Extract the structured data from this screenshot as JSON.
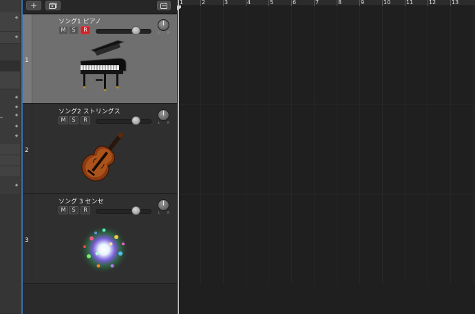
{
  "toolbar": {
    "add_icon": "plus-icon",
    "duplicate_icon": "track-duplicate-icon",
    "filter_icon": "filter-tray-icon"
  },
  "tracks": [
    {
      "number": "1",
      "name": "ソング1 ピアノ",
      "mute": "M",
      "solo": "S",
      "record": "R",
      "record_armed": true,
      "volume": 0.72,
      "instrument_icon": "grand-piano-icon",
      "selected": true
    },
    {
      "number": "2",
      "name": "ソング2 ストリングス",
      "mute": "M",
      "solo": "S",
      "record": "R",
      "record_armed": false,
      "volume": 0.72,
      "instrument_icon": "violin-icon",
      "selected": false
    },
    {
      "number": "3",
      "name": "ソング 3 センセ",
      "mute": "M",
      "solo": "S",
      "record": "R",
      "record_armed": false,
      "volume": 0.72,
      "instrument_icon": "synth-sparkle-icon",
      "selected": false
    }
  ],
  "ruler": {
    "bars": [
      "1",
      "2",
      "3",
      "4",
      "5",
      "6",
      "7",
      "8",
      "9",
      "10",
      "11",
      "12",
      "13"
    ]
  },
  "pan_labels": {
    "left": "L",
    "right": "R"
  },
  "colors": {
    "record_active": "#c8262b",
    "selected_track": "#6f6f6f",
    "playhead_line": "#3a6fb0"
  }
}
